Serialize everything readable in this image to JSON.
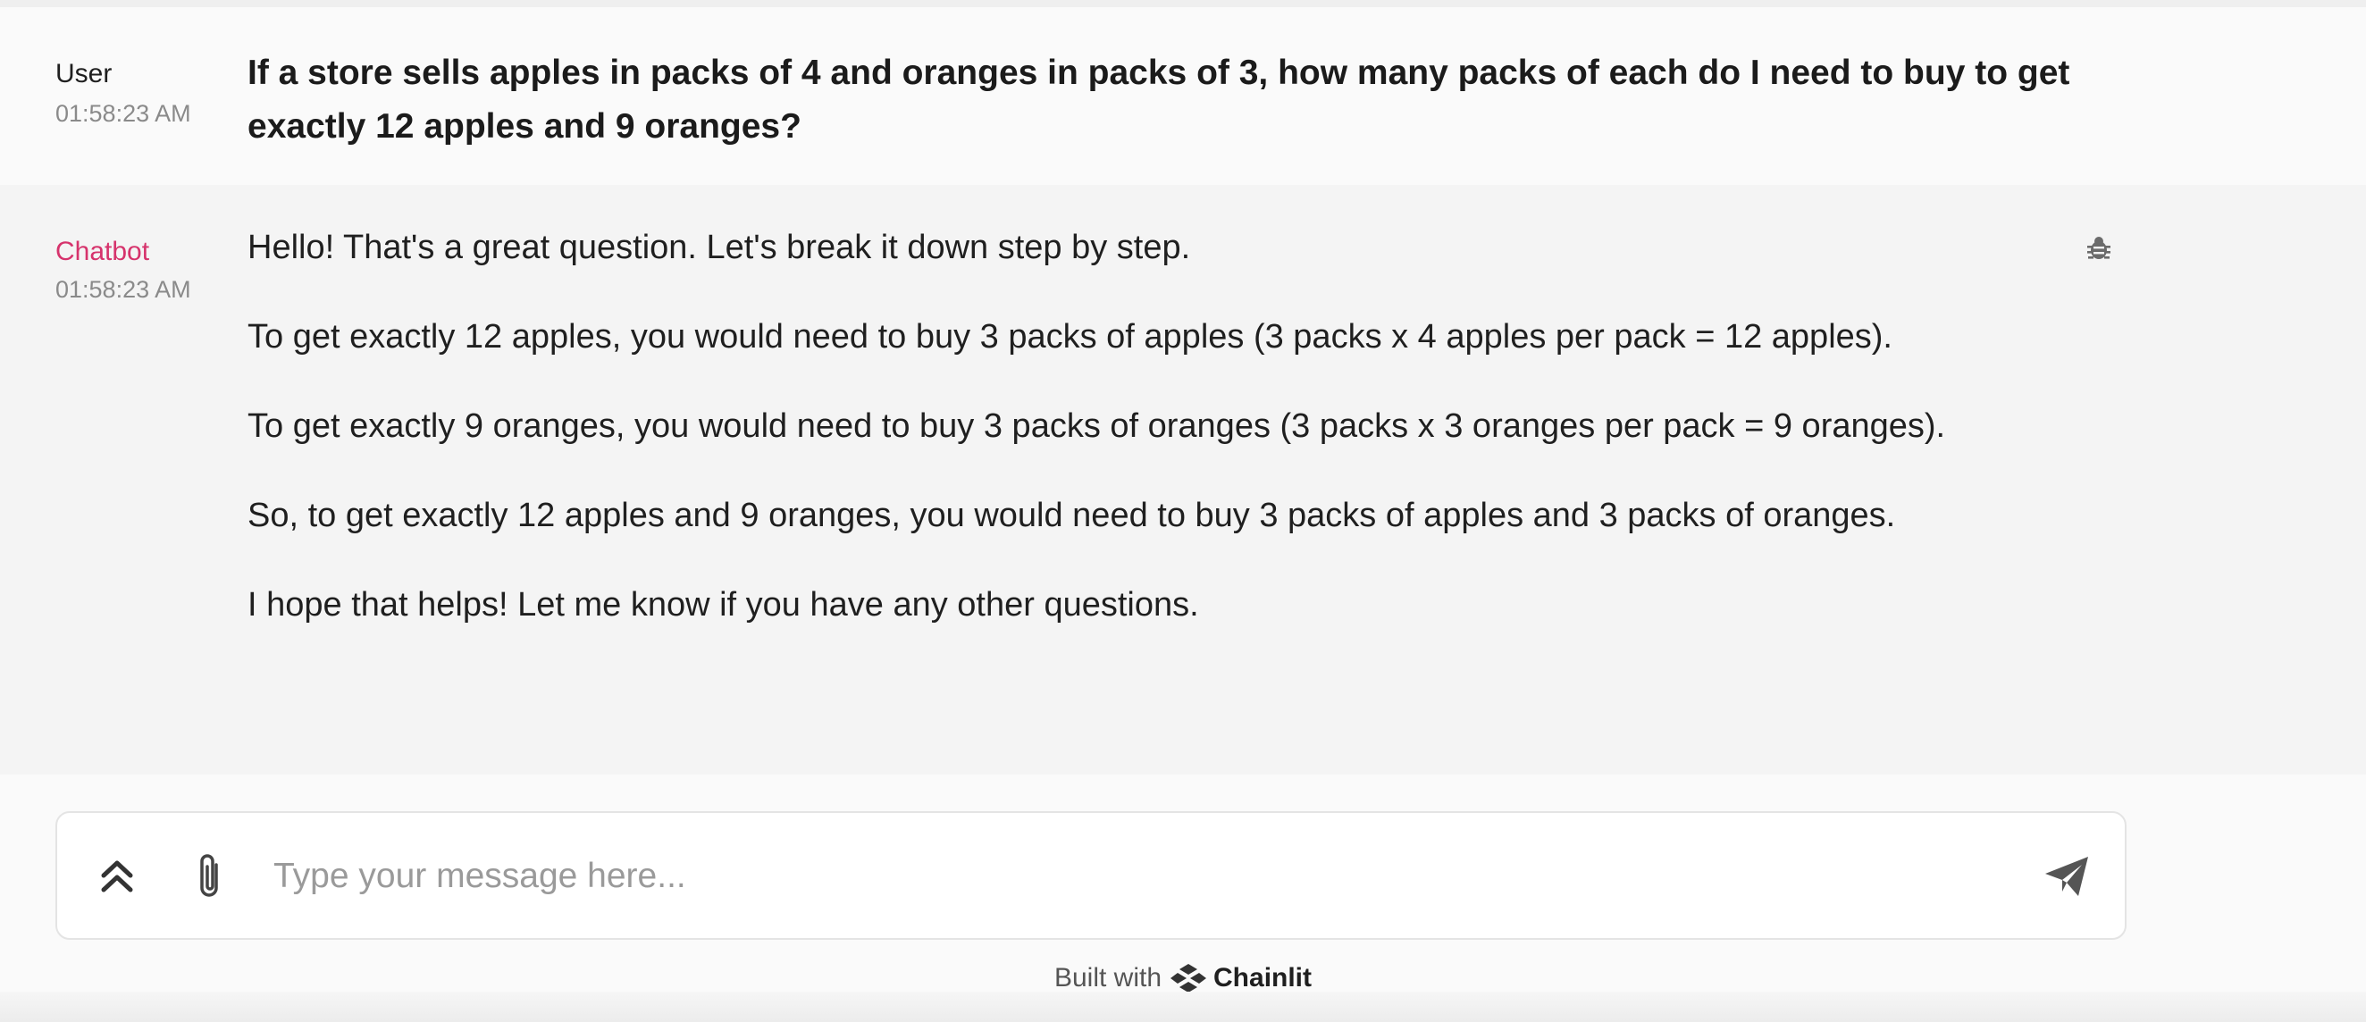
{
  "messages": {
    "user": {
      "author": "User",
      "time": "01:58:23 AM",
      "text": "If a store sells apples in packs of 4 and oranges in packs of 3, how many packs of each do I need to buy to get exactly 12 apples and 9 oranges?"
    },
    "bot": {
      "author": "Chatbot",
      "time": "01:58:23 AM",
      "paragraphs": [
        "Hello! That's a great question. Let's break it down step by step.",
        "To get exactly 12 apples, you would need to buy 3 packs of apples (3 packs x 4 apples per pack = 12 apples).",
        "To get exactly 9 oranges, you would need to buy 3 packs of oranges (3 packs x 3 oranges per pack = 9 oranges).",
        "So, to get exactly 12 apples and 9 oranges, you would need to buy 3 packs of apples and 3 packs of oranges.",
        "I hope that helps! Let me know if you have any other questions."
      ],
      "debug_icon": "bug-icon"
    }
  },
  "composer": {
    "placeholder": "Type your message here...",
    "value": "",
    "settings_icon": "chevrons-up-icon",
    "attach_icon": "paperclip-icon",
    "send_icon": "send-icon"
  },
  "footer": {
    "prefix": "Built with",
    "brand": "Chainlit"
  },
  "colors": {
    "bot_author": "#d6336c",
    "user_bg": "#fafafa",
    "bot_bg": "#f4f4f4"
  }
}
